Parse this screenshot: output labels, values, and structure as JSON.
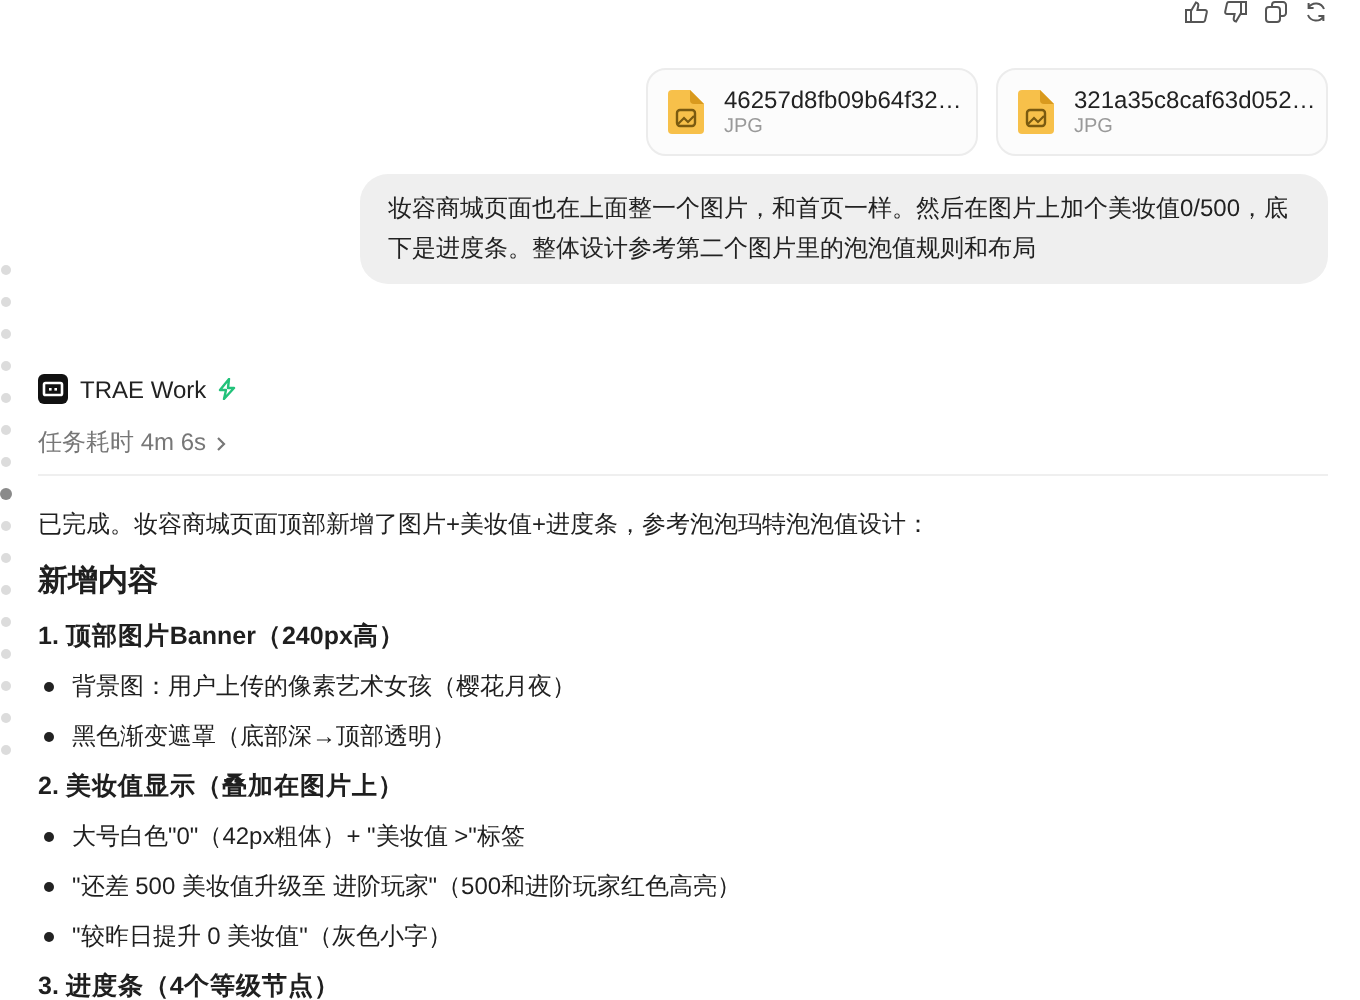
{
  "attachments": [
    {
      "name": "46257d8fb09b64f32…",
      "type": "JPG"
    },
    {
      "name": "321a35c8caf63d052…",
      "type": "JPG"
    }
  ],
  "user_message": "妆容商城页面也在上面整一个图片，和首页一样。然后在图片上加个美妆值0/500，底下是进度条。整体设计参考第二个图片里的泡泡值规则和布局",
  "assistant": {
    "name": "TRAE Work",
    "duration": "任务耗时 4m 6s",
    "blocks": [
      {
        "kind": "paragraph",
        "text": "已完成。妆容商城页面顶部新增了图片+美妆值+进度条，参考泡泡玛特泡泡值设计："
      },
      {
        "kind": "heading",
        "text": "新增内容"
      },
      {
        "kind": "subheading",
        "text": "1. 顶部图片Banner（240px高）"
      },
      {
        "kind": "bullet",
        "text": "背景图：用户上传的像素艺术女孩（樱花月夜）"
      },
      {
        "kind": "bullet",
        "text": "黑色渐变遮罩（底部深→顶部透明）"
      },
      {
        "kind": "subheading",
        "text": "2. 美妆值显示（叠加在图片上）"
      },
      {
        "kind": "bullet",
        "text": "大号白色\"0\"（42px粗体）+ \"美妆值 >\"标签"
      },
      {
        "kind": "bullet",
        "text": "\"还差 500 美妆值升级至 进阶玩家\"（500和进阶玩家红色高亮）"
      },
      {
        "kind": "bullet",
        "text": "\"较昨日提升 0 美妆值\"（灰色小字）"
      },
      {
        "kind": "subheading",
        "text": "3. 进度条（4个等级节点）"
      }
    ]
  }
}
